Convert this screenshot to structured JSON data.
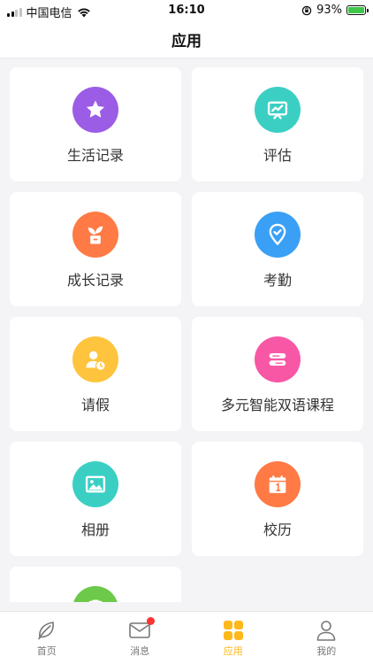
{
  "status_bar": {
    "carrier": "中国电信",
    "time": "16:10",
    "battery": "93%"
  },
  "header": {
    "title": "应用"
  },
  "apps": [
    {
      "label": "生活记录",
      "icon": "star-icon",
      "color": "#9b5de5"
    },
    {
      "label": "评估",
      "icon": "presentation-chart-icon",
      "color": "#3bcfc4"
    },
    {
      "label": "成长记录",
      "icon": "plant-pot-icon",
      "color": "#ff7a45"
    },
    {
      "label": "考勤",
      "icon": "location-check-icon",
      "color": "#3aa0f5"
    },
    {
      "label": "请假",
      "icon": "person-clock-icon",
      "color": "#ffc43d"
    },
    {
      "label": "多元智能双语课程",
      "icon": "book-stack-icon",
      "color": "#f857a6"
    },
    {
      "label": "相册",
      "icon": "picture-icon",
      "color": "#3bcfc4"
    },
    {
      "label": "校历",
      "icon": "calendar-icon",
      "color": "#ff7a45"
    },
    {
      "label": "",
      "icon": "clipboard-icon",
      "color": "#6cc94a"
    }
  ],
  "tab_bar": {
    "tabs": [
      {
        "label": "首页",
        "icon": "leaf-icon",
        "active": false
      },
      {
        "label": "消息",
        "icon": "mail-icon",
        "active": false,
        "badge": true
      },
      {
        "label": "应用",
        "icon": "grid-apps-icon",
        "active": true
      },
      {
        "label": "我的",
        "icon": "person-icon",
        "active": false
      }
    ],
    "active_color": "#ffb81a"
  }
}
